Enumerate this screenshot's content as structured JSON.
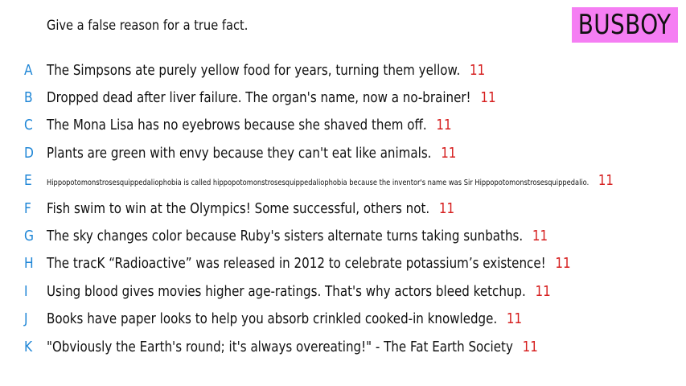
{
  "prompt": "Give a false reason for a true fact.",
  "badge": {
    "label": "BUSBOY",
    "color": "#f57ef3"
  },
  "colors": {
    "letter": "#1f86d6",
    "score": "#d61f1f",
    "text": "#111111"
  },
  "answers": [
    {
      "letter": "A",
      "text": "The Simpsons ate purely yellow food for years, turning them yellow.",
      "score": "11"
    },
    {
      "letter": "B",
      "text": "Dropped dead after liver failure. The organ's name, now a no-brainer!",
      "score": "11"
    },
    {
      "letter": "C",
      "text": "The Mona Lisa has no eyebrows because she shaved them off.",
      "score": "11"
    },
    {
      "letter": "D",
      "text": "Plants are green with envy because they can't eat like animals.",
      "score": "11"
    },
    {
      "letter": "E",
      "text": "Hippopotomonstrosesquippedaliophobia is called hippopotomonstrosesquippedaliophobia because the inventor's name was Sir Hippopotomonstrosesquippedalio.",
      "score": "11"
    },
    {
      "letter": "F",
      "text": "Fish swim to win at the Olympics! Some successful, others not.",
      "score": "11"
    },
    {
      "letter": "G",
      "text": "The sky changes color because Ruby's sisters alternate turns taking sunbaths.",
      "score": "11"
    },
    {
      "letter": "H",
      "text": "The tracK “Radioactive” was released in 2012 to celebrate potassium’s existence!",
      "score": "11"
    },
    {
      "letter": "I",
      "text": "Using blood gives movies higher age-ratings. That's why actors bleed ketchup.",
      "score": "11"
    },
    {
      "letter": "J",
      "text": "Books have paper looks to help you absorb crinkled cooked-in knowledge.",
      "score": "11"
    },
    {
      "letter": "K",
      "text": "\"Obviously the Earth's round; it's always overeating!\" - The Fat Earth Society",
      "score": "11"
    }
  ]
}
